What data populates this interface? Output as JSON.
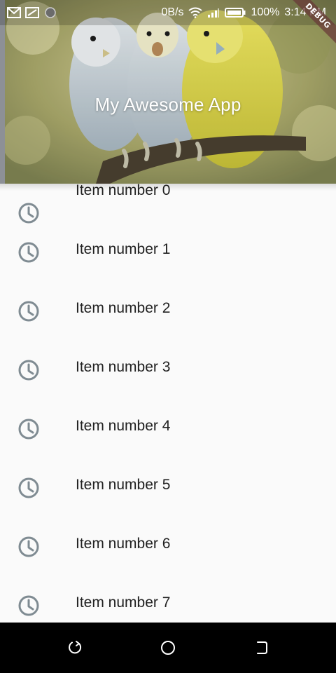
{
  "status_bar": {
    "network_speed": "0B/s",
    "battery_percent": "100%",
    "time": "3:14 PM",
    "left_icons": [
      "gmail-icon",
      "screenshot-icon",
      "sync-icon"
    ],
    "right_icons": [
      "wifi-icon",
      "signal-icon",
      "battery-icon"
    ]
  },
  "debug_banner": {
    "label": "DEBUG"
  },
  "app_bar": {
    "title": "My Awesome App",
    "background_image": "budgerigars-photo"
  },
  "list": {
    "icon": "clock-icon",
    "items": [
      {
        "label": "Item number 0"
      },
      {
        "label": "Item number 1"
      },
      {
        "label": "Item number 2"
      },
      {
        "label": "Item number 3"
      },
      {
        "label": "Item number 4"
      },
      {
        "label": "Item number 5"
      },
      {
        "label": "Item number 6"
      },
      {
        "label": "Item number 7"
      }
    ]
  },
  "nav_bar": {
    "buttons": [
      "back-icon",
      "home-icon",
      "recents-icon"
    ]
  },
  "colors": {
    "icon_grey": "#7f8b92",
    "text_primary": "#212121",
    "list_background": "#fafafa",
    "nav_background": "#000000"
  }
}
